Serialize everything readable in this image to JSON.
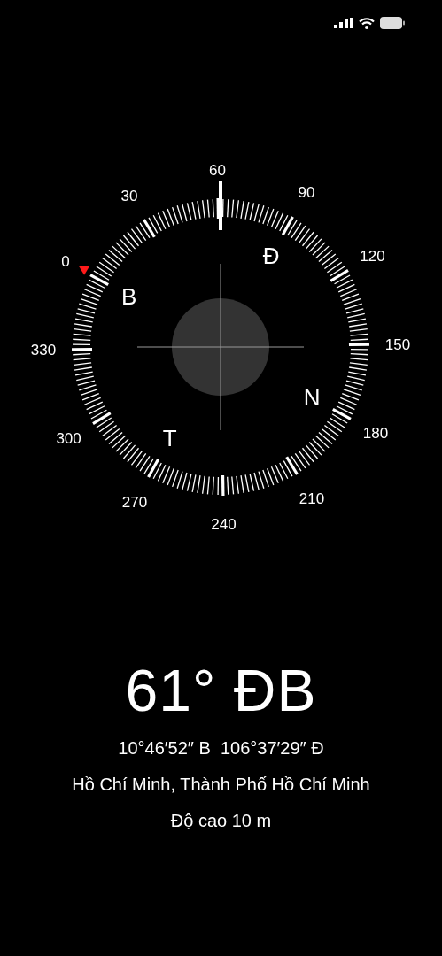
{
  "compass": {
    "degree_labels": [
      "0",
      "30",
      "60",
      "90",
      "120",
      "150",
      "180",
      "210",
      "240",
      "270",
      "300",
      "330"
    ],
    "cardinal_labels": [
      "B",
      "Đ",
      "N",
      "T"
    ]
  },
  "heading": "61° ĐB",
  "coordinates": "10°46′52″ B  106°37′29″ Đ",
  "location": "Hồ Chí Minh, Thành Phố Hồ Chí Minh",
  "altitude": "Độ cao 10 m"
}
